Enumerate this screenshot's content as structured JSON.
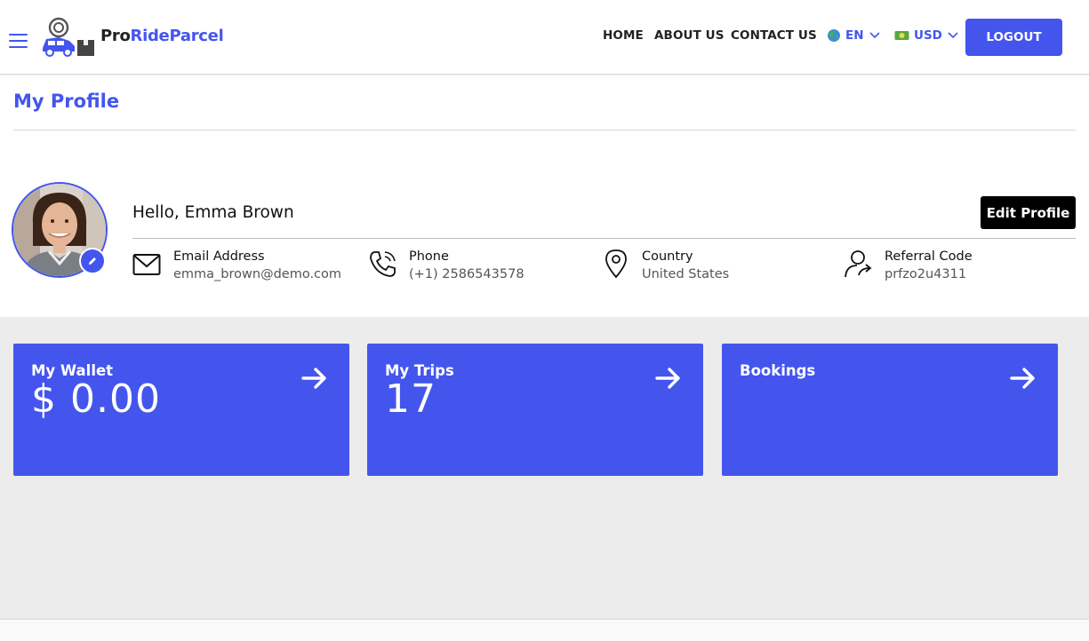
{
  "brand": {
    "name_part1": "Pro",
    "name_part2": "RideParcel",
    "primary_color": "#4455ee"
  },
  "nav": {
    "home": "HOME",
    "about": "ABOUT US",
    "contact": "CONTACT US",
    "language": {
      "label": "EN",
      "icon": "globe-icon"
    },
    "currency": {
      "label": "USD",
      "icon": "banknote-icon"
    },
    "logout": "LOGOUT"
  },
  "page": {
    "title": "My Profile"
  },
  "profile": {
    "greeting": "Hello, Emma Brown",
    "edit_button": "Edit Profile",
    "fields": [
      {
        "label": "Email Address",
        "value": "emma_brown@demo.com",
        "icon": "mail-icon"
      },
      {
        "label": "Phone",
        "value": "(+1) 2586543578",
        "icon": "phone-icon"
      },
      {
        "label": "Country",
        "value": "United States",
        "icon": "location-pin-icon"
      },
      {
        "label": "Referral Code",
        "value": "prfzo2u4311",
        "icon": "user-share-icon"
      }
    ]
  },
  "cards": [
    {
      "title": "My Wallet",
      "value": "$ 0.00"
    },
    {
      "title": "My Trips",
      "value": "17"
    },
    {
      "title": "Bookings",
      "value": ""
    }
  ]
}
